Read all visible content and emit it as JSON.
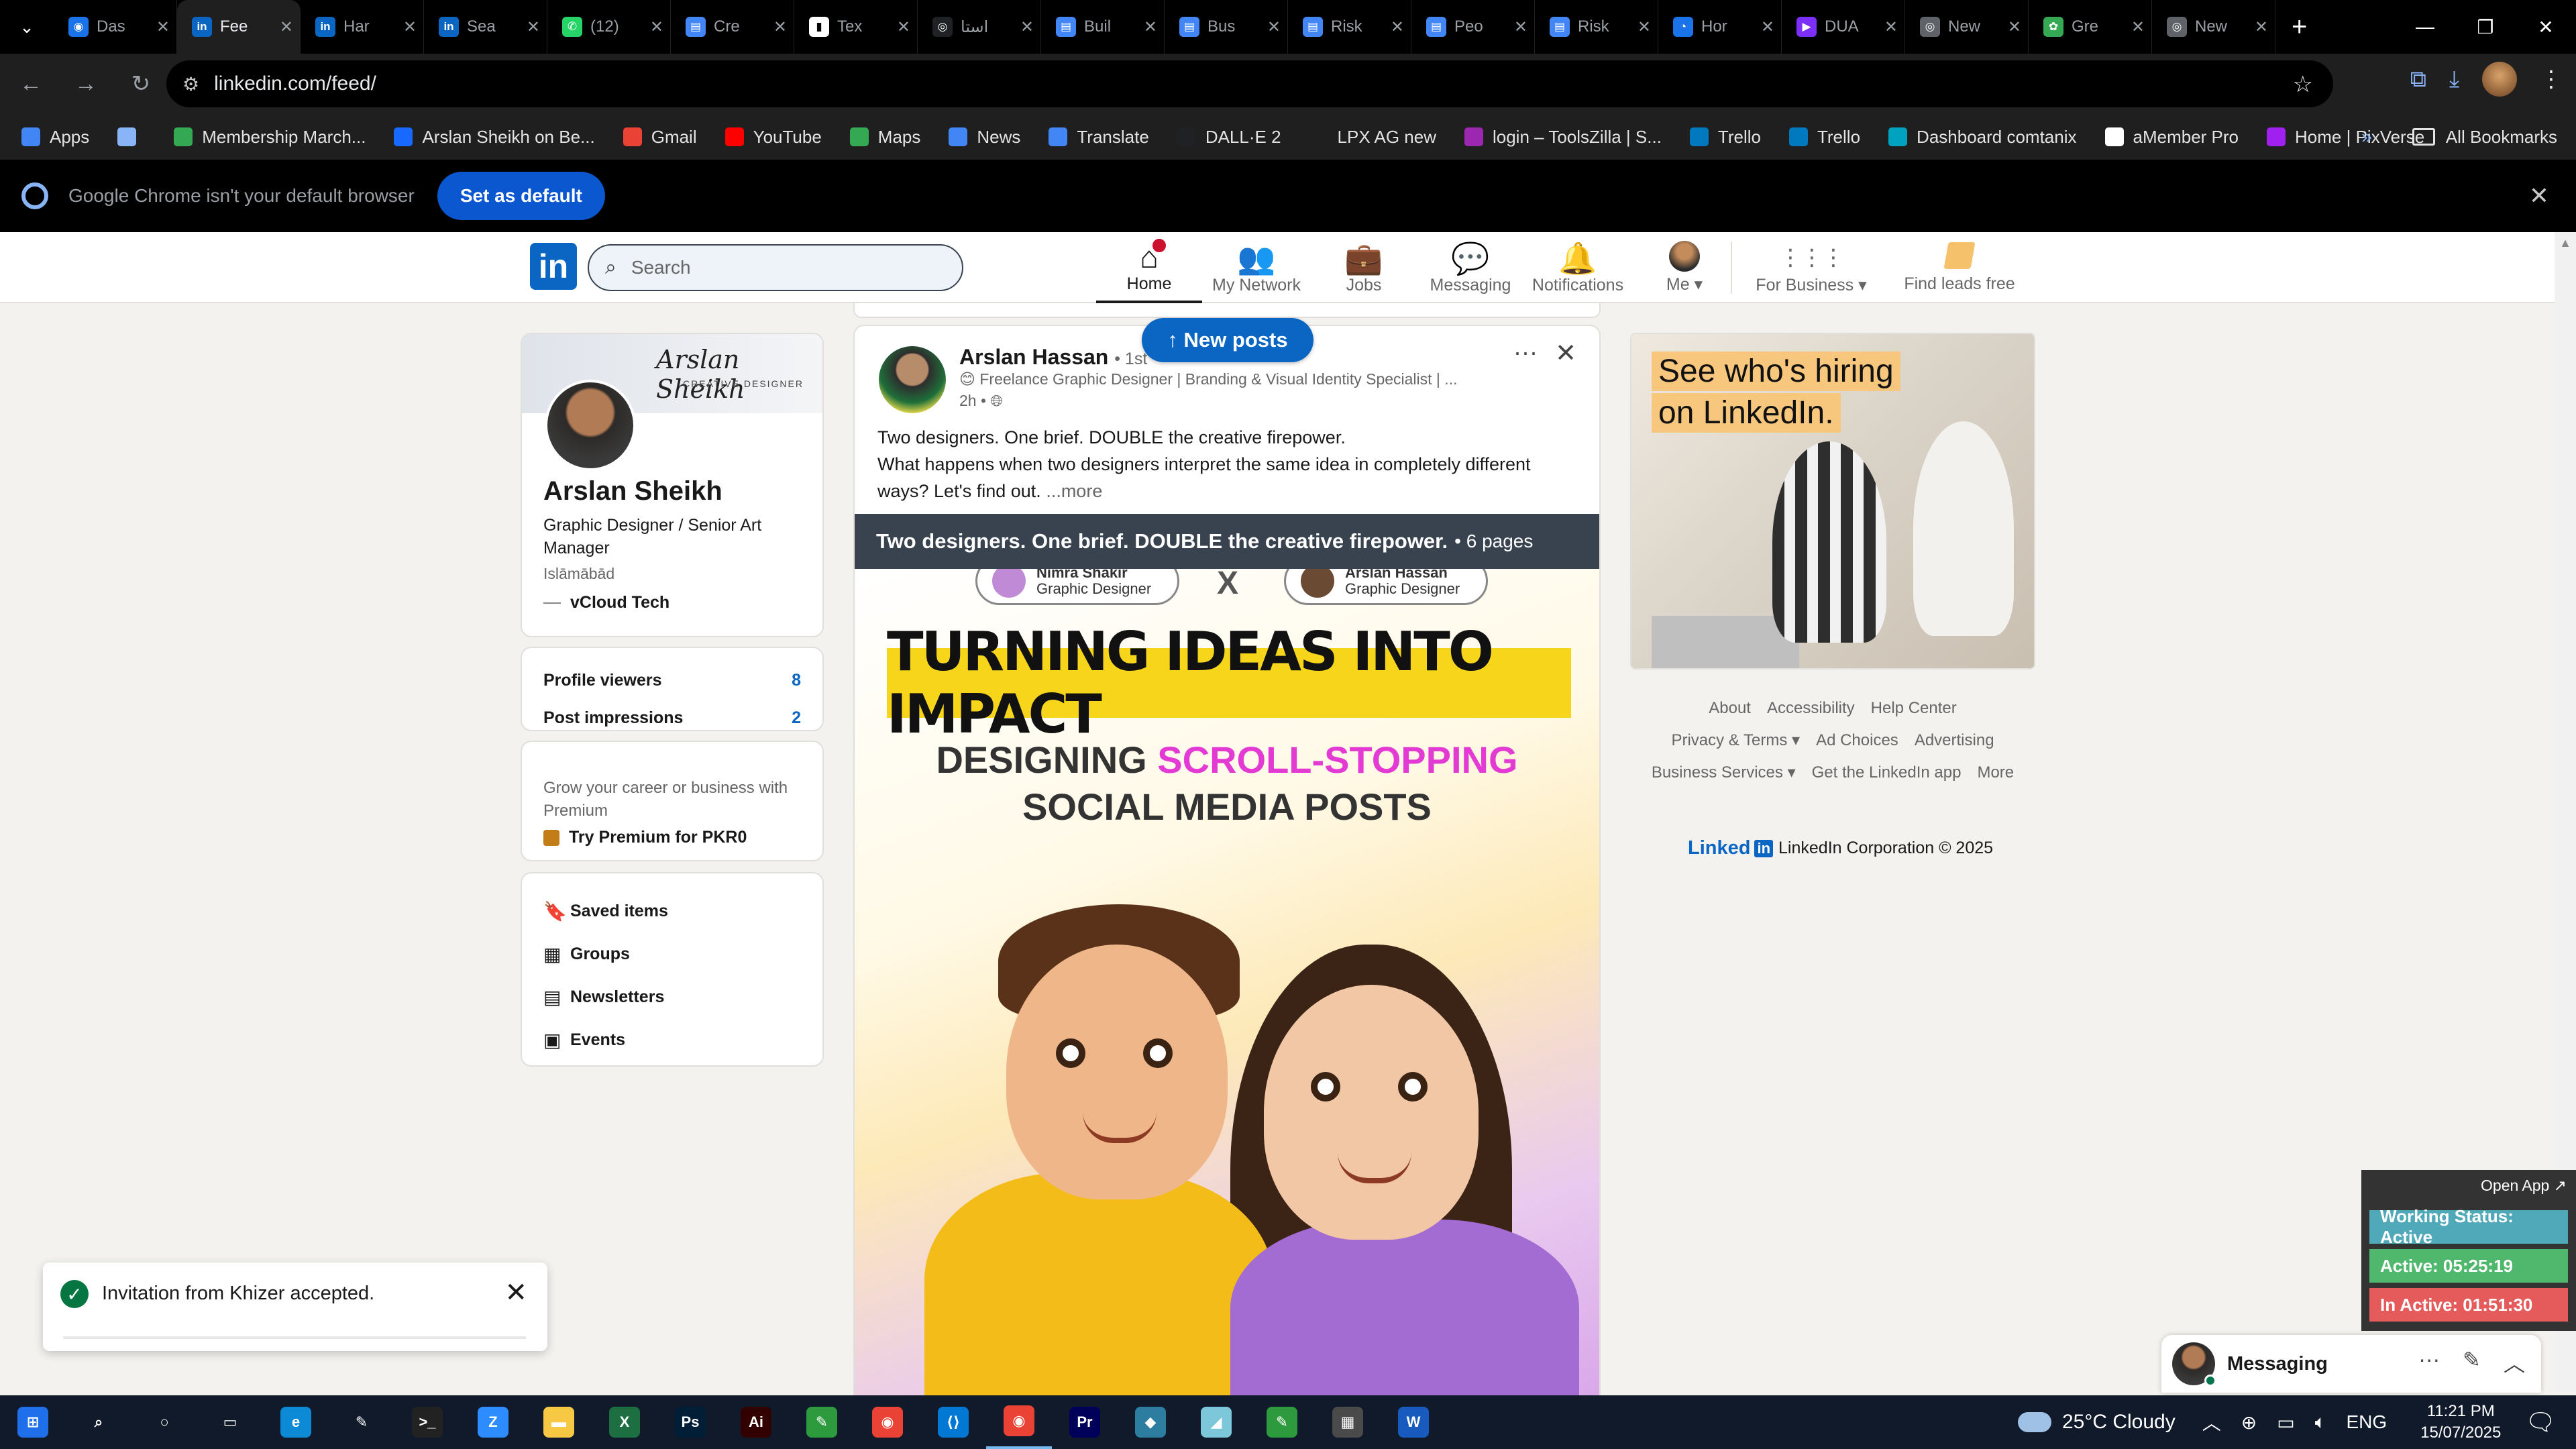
{
  "browser": {
    "tabs": [
      {
        "title": "Das",
        "color": "#1a73e8",
        "glyph": "◉"
      },
      {
        "title": "Fee",
        "color": "#0a66c2",
        "glyph": "in"
      },
      {
        "title": "Har",
        "color": "#0a66c2",
        "glyph": "in"
      },
      {
        "title": "Sea",
        "color": "#0a66c2",
        "glyph": "in"
      },
      {
        "title": "(12)",
        "color": "#25d366",
        "glyph": "✆"
      },
      {
        "title": "Cre",
        "color": "#4285f4",
        "glyph": "▤"
      },
      {
        "title": "Tex",
        "color": "#ffffff",
        "glyph": "▮"
      },
      {
        "title": "استا",
        "color": "#202124",
        "glyph": "◎"
      },
      {
        "title": "Buil",
        "color": "#4285f4",
        "glyph": "▤"
      },
      {
        "title": "Bus",
        "color": "#4285f4",
        "glyph": "▤"
      },
      {
        "title": "Risk",
        "color": "#4285f4",
        "glyph": "▤"
      },
      {
        "title": "Peo",
        "color": "#4285f4",
        "glyph": "▤"
      },
      {
        "title": "Risk",
        "color": "#4285f4",
        "glyph": "▤"
      },
      {
        "title": "Hor",
        "color": "#1a73e8",
        "glyph": "◔"
      },
      {
        "title": "DUA",
        "color": "#7b2ff7",
        "glyph": "▶"
      },
      {
        "title": "New",
        "color": "#5f6368",
        "glyph": "◎"
      },
      {
        "title": "Gre",
        "color": "#34a853",
        "glyph": "✿"
      },
      {
        "title": "New",
        "color": "#5f6368",
        "glyph": "◎"
      }
    ],
    "active_tab_index": 1,
    "url": "linkedin.com/feed/",
    "bookmarks": [
      {
        "label": "Apps",
        "color": "#4285f4"
      },
      {
        "label": "",
        "color": "#8ab4f8"
      },
      {
        "label": "Membership March...",
        "color": "#34a853"
      },
      {
        "label": "Arslan Sheikh on Be...",
        "color": "#1769ff"
      },
      {
        "label": "Gmail",
        "color": "#ea4335"
      },
      {
        "label": "YouTube",
        "color": "#ff0000"
      },
      {
        "label": "Maps",
        "color": "#34a853"
      },
      {
        "label": "News",
        "color": "#4285f4"
      },
      {
        "label": "Translate",
        "color": "#4285f4"
      },
      {
        "label": "DALL·E 2",
        "color": "#202124"
      },
      {
        "label": "LPX AG new",
        "color": "#1f1f1f"
      },
      {
        "label": "login – ToolsZilla | S...",
        "color": "#9c27b0"
      },
      {
        "label": "Trello",
        "color": "#0079bf"
      },
      {
        "label": "Trello",
        "color": "#0079bf"
      },
      {
        "label": "Dashboard comtanix",
        "color": "#00a3bf"
      },
      {
        "label": "aMember Pro",
        "color": "#ffffff"
      },
      {
        "label": "Home | PixVerse",
        "color": "#a020f0"
      }
    ],
    "all_bookmarks": "All Bookmarks",
    "infobar_message": "Google Chrome isn't your default browser",
    "set_default_label": "Set as default"
  },
  "linkedin": {
    "search_placeholder": "Search",
    "nav": [
      {
        "label": "Home",
        "glyph": "⌂"
      },
      {
        "label": "My Network",
        "glyph": "👥"
      },
      {
        "label": "Jobs",
        "glyph": "💼"
      },
      {
        "label": "Messaging",
        "glyph": "💬"
      },
      {
        "label": "Notifications",
        "glyph": "🔔"
      },
      {
        "label": "Me ▾",
        "glyph": ""
      },
      {
        "label": "For Business ▾",
        "glyph": "⋮⋮⋮"
      },
      {
        "label": "Find leads free",
        "glyph": ""
      }
    ],
    "profile": {
      "banner_signature": "Arslan Sheikh",
      "banner_subtitle": "CREATIVE DESIGNER",
      "name": "Arslan Sheikh",
      "headline": "Graphic Designer / Senior Art Manager",
      "location": "Islāmābād",
      "company": "vCloud Tech"
    },
    "stats": [
      {
        "label": "Profile viewers",
        "value": "8"
      },
      {
        "label": "Post impressions",
        "value": "2"
      }
    ],
    "premium": {
      "text": "Grow your career or business with Premium",
      "link": "Try Premium for PKR0"
    },
    "shortcuts": [
      {
        "label": "Saved items",
        "glyph": "🔖"
      },
      {
        "label": "Groups",
        "glyph": "▦"
      },
      {
        "label": "Newsletters",
        "glyph": "▤"
      },
      {
        "label": "Events",
        "glyph": "▣"
      }
    ],
    "new_posts_label": "↑ New posts",
    "post": {
      "author": "Arslan Hassan",
      "degree": "• 1st",
      "headline": "😊 Freelance Graphic Designer | Branding & Visual Identity Specialist | ...",
      "time": "2h •",
      "text_line1": "Two designers. One brief. DOUBLE the creative firepower.",
      "text_line2": "What happens when two designers interpret the same idea in completely different ways? Let's find out.",
      "see_more": "...more",
      "doc_title": "Two designers. One brief. DOUBLE the creative firepower.",
      "doc_pages": "• 6 pages",
      "pill_left_name": "Nimra Shakir",
      "pill_left_role": "Graphic Designer",
      "pill_right_name": "Arslan Hassan",
      "pill_right_role": "Graphic Designer",
      "pill_x": "X",
      "doc_heading": "TURNING IDEAS INTO IMPACT",
      "doc_sub_a": "DESIGNING",
      "doc_sub_b": "SCROLL-STOPPING",
      "doc_sub_c": "SOCIAL MEDIA POSTS"
    },
    "ad": {
      "line1": "See who's hiring",
      "line2": "on LinkedIn."
    },
    "footer_links": [
      "About",
      "Accessibility",
      "Help Center",
      "Privacy & Terms ▾",
      "Ad Choices",
      "Advertising",
      "Business Services ▾",
      "Get the LinkedIn app",
      "More"
    ],
    "footer_brand": "Linked",
    "footer_brand_in": "in",
    "footer_copyright": "LinkedIn Corporation © 2025",
    "toast_message": "Invitation from Khizer accepted.",
    "messaging_label": "Messaging"
  },
  "tracker": {
    "open_app": "Open App ↗",
    "status": "Working Status: Active",
    "active": "Active: 05:25:19",
    "inactive": "In Active: 01:51:30"
  },
  "taskbar": {
    "apps": [
      {
        "name": "windows-start",
        "color": "#1f6feb",
        "glyph": "⊞"
      },
      {
        "name": "search",
        "color": "transparent",
        "glyph": "⌕"
      },
      {
        "name": "cortana",
        "color": "transparent",
        "glyph": "○"
      },
      {
        "name": "task-view",
        "color": "transparent",
        "glyph": "▭"
      },
      {
        "name": "edge",
        "color": "#0c8ad6",
        "glyph": "e"
      },
      {
        "name": "pen",
        "color": "transparent",
        "glyph": "✎"
      },
      {
        "name": "terminal",
        "color": "#222",
        "glyph": ">_"
      },
      {
        "name": "zoom",
        "color": "#2d8cff",
        "glyph": "Z"
      },
      {
        "name": "file-explorer",
        "color": "#f7c843",
        "glyph": "▬"
      },
      {
        "name": "excel",
        "color": "#1d6f42",
        "glyph": "X"
      },
      {
        "name": "photoshop",
        "color": "#001e36",
        "glyph": "Ps"
      },
      {
        "name": "illustrator",
        "color": "#330000",
        "glyph": "Ai"
      },
      {
        "name": "app-green",
        "color": "#2e9a3e",
        "glyph": "✎"
      },
      {
        "name": "chrome",
        "color": "#ea4335",
        "glyph": "◉"
      },
      {
        "name": "vscode",
        "color": "#0078d4",
        "glyph": "⟨⟩"
      },
      {
        "name": "chrome-active",
        "color": "#ea4335",
        "glyph": "◉"
      },
      {
        "name": "premiere",
        "color": "#00005b",
        "glyph": "Pr"
      },
      {
        "name": "app-teal",
        "color": "#2c7da0",
        "glyph": "◆"
      },
      {
        "name": "app-cyan",
        "color": "#7cc7d9",
        "glyph": "◢"
      },
      {
        "name": "app-green2",
        "color": "#2e9a3e",
        "glyph": "✎"
      },
      {
        "name": "calculator",
        "color": "#4a4a4a",
        "glyph": "▦"
      },
      {
        "name": "word",
        "color": "#185abd",
        "glyph": "W"
      }
    ],
    "active_index": 15,
    "weather": "25°C  Cloudy",
    "language": "ENG",
    "time": "11:21 PM",
    "date": "15/07/2025"
  }
}
